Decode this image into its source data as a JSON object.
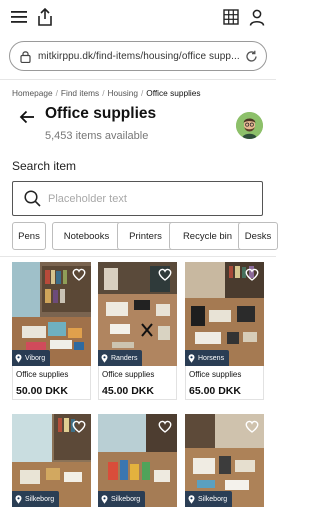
{
  "browser": {
    "url": "mitkirppu.dk/find-items/housing/office supp..."
  },
  "breadcrumb": {
    "items": [
      "Homepage",
      "Find items",
      "Housing",
      "Office supplies"
    ]
  },
  "header": {
    "title": "Office supplies",
    "subtitle": "5,453 items available"
  },
  "search": {
    "label": "Search item",
    "placeholder": "Placeholder text"
  },
  "filters": [
    "Pens",
    "Notebooks",
    "Printers",
    "Recycle bin",
    "Desks"
  ],
  "listings": [
    {
      "location": "Viborg",
      "name": "Office supplies",
      "price": "50.00 DKK"
    },
    {
      "location": "Randers",
      "name": "Office supplies",
      "price": "45.00 DKK"
    },
    {
      "location": "Horsens",
      "name": "Office supplies",
      "price": "65.00 DKK"
    },
    {
      "location": "Silkeborg",
      "name": "",
      "price": ""
    },
    {
      "location": "Silkeborg",
      "name": "",
      "price": ""
    },
    {
      "location": "Silkeborg",
      "name": "",
      "price": ""
    }
  ],
  "colors": {
    "location_badge": "#143255",
    "heart": "#ffffff",
    "avatar_bg": "#8dc06a"
  },
  "icons": {
    "menu": "hamburger-icon",
    "share": "share-icon",
    "grid": "grid-icon",
    "account": "user-icon",
    "lock": "lock-icon",
    "reload": "reload-icon",
    "back": "arrow-left-icon",
    "search": "search-icon",
    "favorite": "heart-icon",
    "location": "location-pin-icon"
  }
}
